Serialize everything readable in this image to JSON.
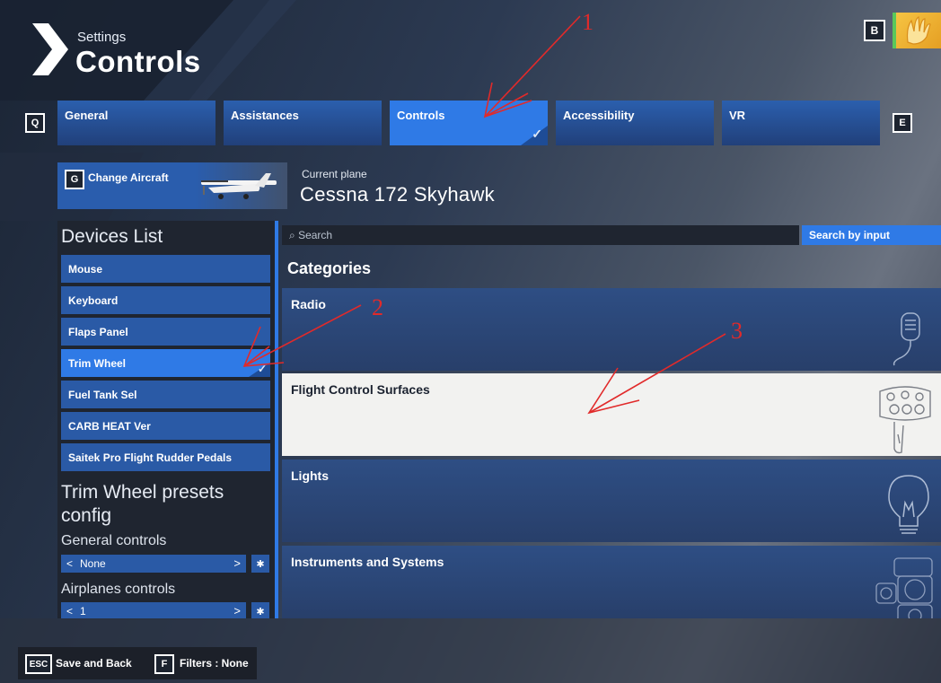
{
  "header": {
    "subtitle": "Settings",
    "title": "Controls",
    "profile_key": "B"
  },
  "tabs": {
    "prev_key": "Q",
    "next_key": "E",
    "items": [
      {
        "label": "General"
      },
      {
        "label": "Assistances"
      },
      {
        "label": "Controls",
        "active": true
      },
      {
        "label": "Accessibility"
      },
      {
        "label": "VR"
      }
    ]
  },
  "aircraft": {
    "key": "G",
    "button_label": "Change Aircraft",
    "current_label": "Current plane",
    "current_plane": "Cessna 172 Skyhawk"
  },
  "devices": {
    "title": "Devices List",
    "items": [
      {
        "label": "Mouse"
      },
      {
        "label": "Keyboard"
      },
      {
        "label": "Flaps Panel"
      },
      {
        "label": "Trim Wheel",
        "active": true
      },
      {
        "label": "Fuel Tank Sel"
      },
      {
        "label": "CARB HEAT Ver"
      },
      {
        "label": "Saitek Pro Flight Rudder Pedals"
      }
    ],
    "presets_title": "Trim Wheel presets config",
    "general_controls_label": "General controls",
    "general_controls_value": "None",
    "airplanes_controls_label": "Airplanes controls",
    "airplanes_controls_value": "1"
  },
  "search": {
    "placeholder": "Search",
    "by_input_label": "Search by input"
  },
  "categories": {
    "title": "Categories",
    "items": [
      {
        "label": "Radio",
        "icon": "microphone-icon"
      },
      {
        "label": "Flight Control Surfaces",
        "icon": "yoke-icon",
        "selected": true
      },
      {
        "label": "Lights",
        "icon": "lightbulb-icon"
      },
      {
        "label": "Instruments and Systems",
        "icon": "instruments-icon"
      }
    ]
  },
  "bottom": {
    "esc_key": "ESC",
    "save_label": "Save and Back",
    "filters_key": "F",
    "filters_label": "Filters : None"
  },
  "annotations": {
    "n1": "1",
    "n2": "2",
    "n3": "3",
    "color": "#e12a2a"
  },
  "colors": {
    "accent": "#2f7ae6",
    "tab": "#2b5fae",
    "panel": "#1f2530",
    "selected_card": "#f2f2f0"
  }
}
